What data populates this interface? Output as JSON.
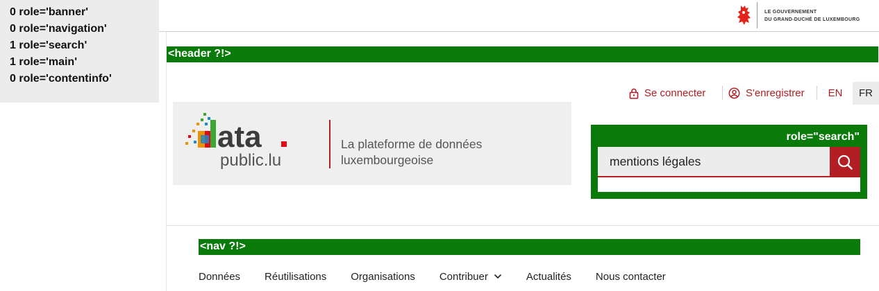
{
  "landmarks": [
    {
      "count": "0",
      "role": "role='banner'"
    },
    {
      "count": "0",
      "role": "role='navigation'"
    },
    {
      "count": "1",
      "role": "role='search'"
    },
    {
      "count": "1",
      "role": "role='main'"
    },
    {
      "count": "0",
      "role": "role='contentinfo'"
    }
  ],
  "gov": {
    "line1": "Le gouvernement",
    "line2": "du Grand-Duché de Luxembourg",
    "logo_icon": "red-lion-icon"
  },
  "debug": {
    "header_label": "<header ?!>",
    "nav_label": "<nav ?!>",
    "search_label": "role=\"search\"",
    "color": "#0a7b0a"
  },
  "auth": {
    "login_label": "Se connecter",
    "register_label": "S'enregistrer"
  },
  "languages": {
    "en": "EN",
    "fr": "FR",
    "active": "FR"
  },
  "brand": {
    "logo_word": "data.",
    "logo_sub_a": "public.",
    "logo_sub_b": "lu",
    "tagline_line1": "La plateforme de données",
    "tagline_line2": "luxembourgeoise",
    "accent": "#b21e23"
  },
  "search": {
    "value": "mentions légales",
    "button_icon": "search-icon"
  },
  "nav": {
    "items": [
      {
        "label": "Données"
      },
      {
        "label": "Réutilisations"
      },
      {
        "label": "Organisations"
      },
      {
        "label": "Contribuer",
        "dropdown": true
      },
      {
        "label": "Actualités"
      },
      {
        "label": "Nous contacter"
      }
    ]
  }
}
